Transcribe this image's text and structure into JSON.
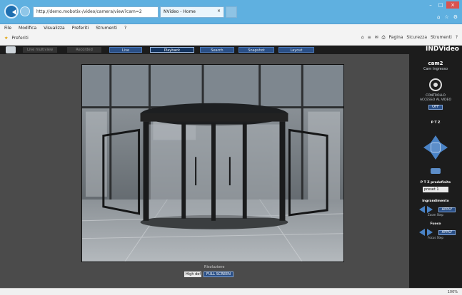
{
  "browser": {
    "address": "http://demo.mobotix-/video/camera/view?cam=2",
    "address_host": "mobotix",
    "tab_title": "NVideo - Home",
    "tab_close": "×",
    "menu": [
      "File",
      "Modifica",
      "Visualizza",
      "Preferiti",
      "Strumenti",
      "?"
    ],
    "favorites": "Preferiti",
    "commands": [
      "Pagina",
      "Sicurezza",
      "Strumenti"
    ],
    "zoom": "100%",
    "controls": {
      "minimize": "–",
      "maximize": "□",
      "close": "×"
    }
  },
  "app": {
    "brand": "INDVideo",
    "toolbar": {
      "btn1": "Live multiview",
      "btn2": "Recorded",
      "btn3": "Live",
      "btn4": "Playback",
      "btn5": "Search",
      "btn6": "Snapshot",
      "btn7": "Layout"
    },
    "camera": {
      "name": "cam2",
      "location": "Cam Ingresso"
    },
    "panel": {
      "pointer_label": "CONTROLLO\nACCESSO AL VIDEO",
      "pointer_btn": "OFF",
      "ptz_title": "P T Z",
      "preset_title": "P T Z predefinite",
      "preset_value": "preset 1",
      "zoom_title": "Ingrandimento",
      "zoom_apply": "APPLY",
      "zoom_hint": "Zoom Step",
      "focus_title": "Fuoco",
      "focus_apply": "APPLY",
      "focus_hint": "Focus Step"
    },
    "video": {
      "bottom_label": "Risoluzione",
      "select_value": "High def",
      "button": "FULL SCREEN"
    }
  },
  "colors": {
    "accent": "#2a4f86",
    "panel": "#1c1c1c",
    "content": "#4b4b4b"
  }
}
